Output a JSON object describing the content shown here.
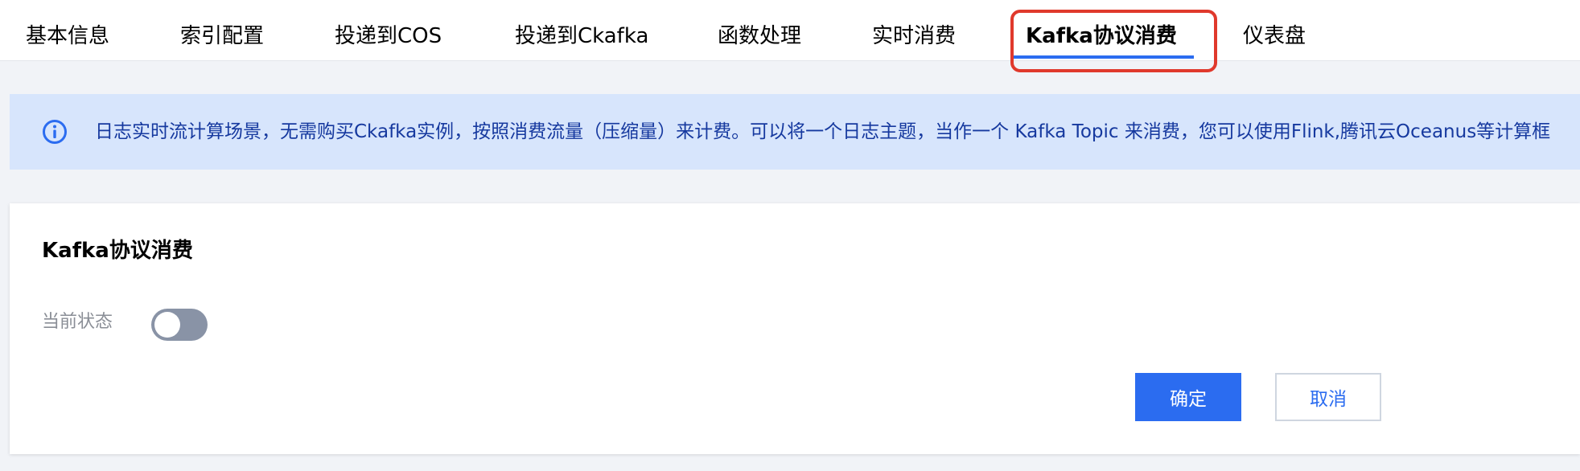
{
  "tabs": [
    {
      "label": "基本信息"
    },
    {
      "label": "索引配置"
    },
    {
      "label": "投递到COS"
    },
    {
      "label": "投递到Ckafka"
    },
    {
      "label": "函数处理"
    },
    {
      "label": "实时消费"
    },
    {
      "label": "Kafka协议消费",
      "active": true
    },
    {
      "label": "仪表盘"
    }
  ],
  "notice": {
    "icon": "info-icon",
    "text": "日志实时流计算场景，无需购买Ckafka实例，按照消费流量（压缩量）来计费。可以将一个日志主题，当作一个 Kafka Topic 来消费，您可以使用Flink,腾讯云Oceanus等计算框"
  },
  "card": {
    "title": "Kafka协议消费",
    "status_label": "当前状态",
    "status_on": false,
    "confirm_label": "确定",
    "cancel_label": "取消"
  },
  "colors": {
    "accent": "#2b6cf0",
    "highlight": "#e0392c",
    "notice_bg": "#d7e5fc",
    "notice_text": "#16399f",
    "toggle_off": "#8993a6"
  }
}
